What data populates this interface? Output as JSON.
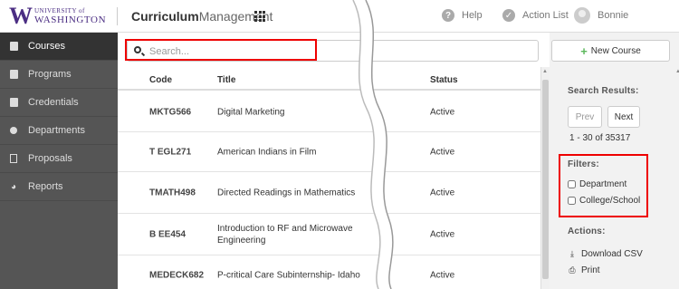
{
  "header": {
    "logo_university": "UNIVERSITY of",
    "logo_washington": "WASHINGTON",
    "app_title_bold": "Curriculum",
    "app_title_light": "Management",
    "help_label": "Help",
    "action_list_label": "Action List",
    "user_name": "Bonnie"
  },
  "sidebar": {
    "items": [
      {
        "label": "Courses",
        "icon": "book-icon"
      },
      {
        "label": "Programs",
        "icon": "books-icon"
      },
      {
        "label": "Credentials",
        "icon": "books-icon"
      },
      {
        "label": "Departments",
        "icon": "pin-icon"
      },
      {
        "label": "Proposals",
        "icon": "document-icon"
      },
      {
        "label": "Reports",
        "icon": "pie-chart-icon"
      }
    ]
  },
  "search": {
    "placeholder": "Search...",
    "value": ""
  },
  "table": {
    "columns": [
      "Code",
      "Title",
      "Status"
    ],
    "rows": [
      {
        "code": "MKTG566",
        "title": "Digital Marketing",
        "status": "Active"
      },
      {
        "code": "T EGL271",
        "title": "American Indians in Film",
        "status": "Active"
      },
      {
        "code": "TMATH498",
        "title": "Directed Readings in Mathematics",
        "status": "Active"
      },
      {
        "code": "B EE454",
        "title": "Introduction to RF and Microwave Engineering",
        "status": "Active"
      },
      {
        "code": "MEDECK682",
        "title": "P-critical Care Subinternship- Idaho",
        "status": "Active"
      }
    ]
  },
  "panel": {
    "new_course_label": "New Course",
    "search_results_heading": "Search Results:",
    "prev_label": "Prev",
    "next_label": "Next",
    "range_text": "1 - 30 of 35317",
    "filters_heading": "Filters:",
    "filter_department": "Department",
    "filter_college": "College/School",
    "actions_heading": "Actions:",
    "download_csv_label": "Download CSV",
    "print_label": "Print"
  },
  "colors": {
    "brand_purple": "#4b2e83",
    "sidebar_bg": "#555555",
    "sidebar_active_bg": "#333333",
    "highlight_red": "#e00000",
    "new_course_plus": "#5cb85c"
  }
}
